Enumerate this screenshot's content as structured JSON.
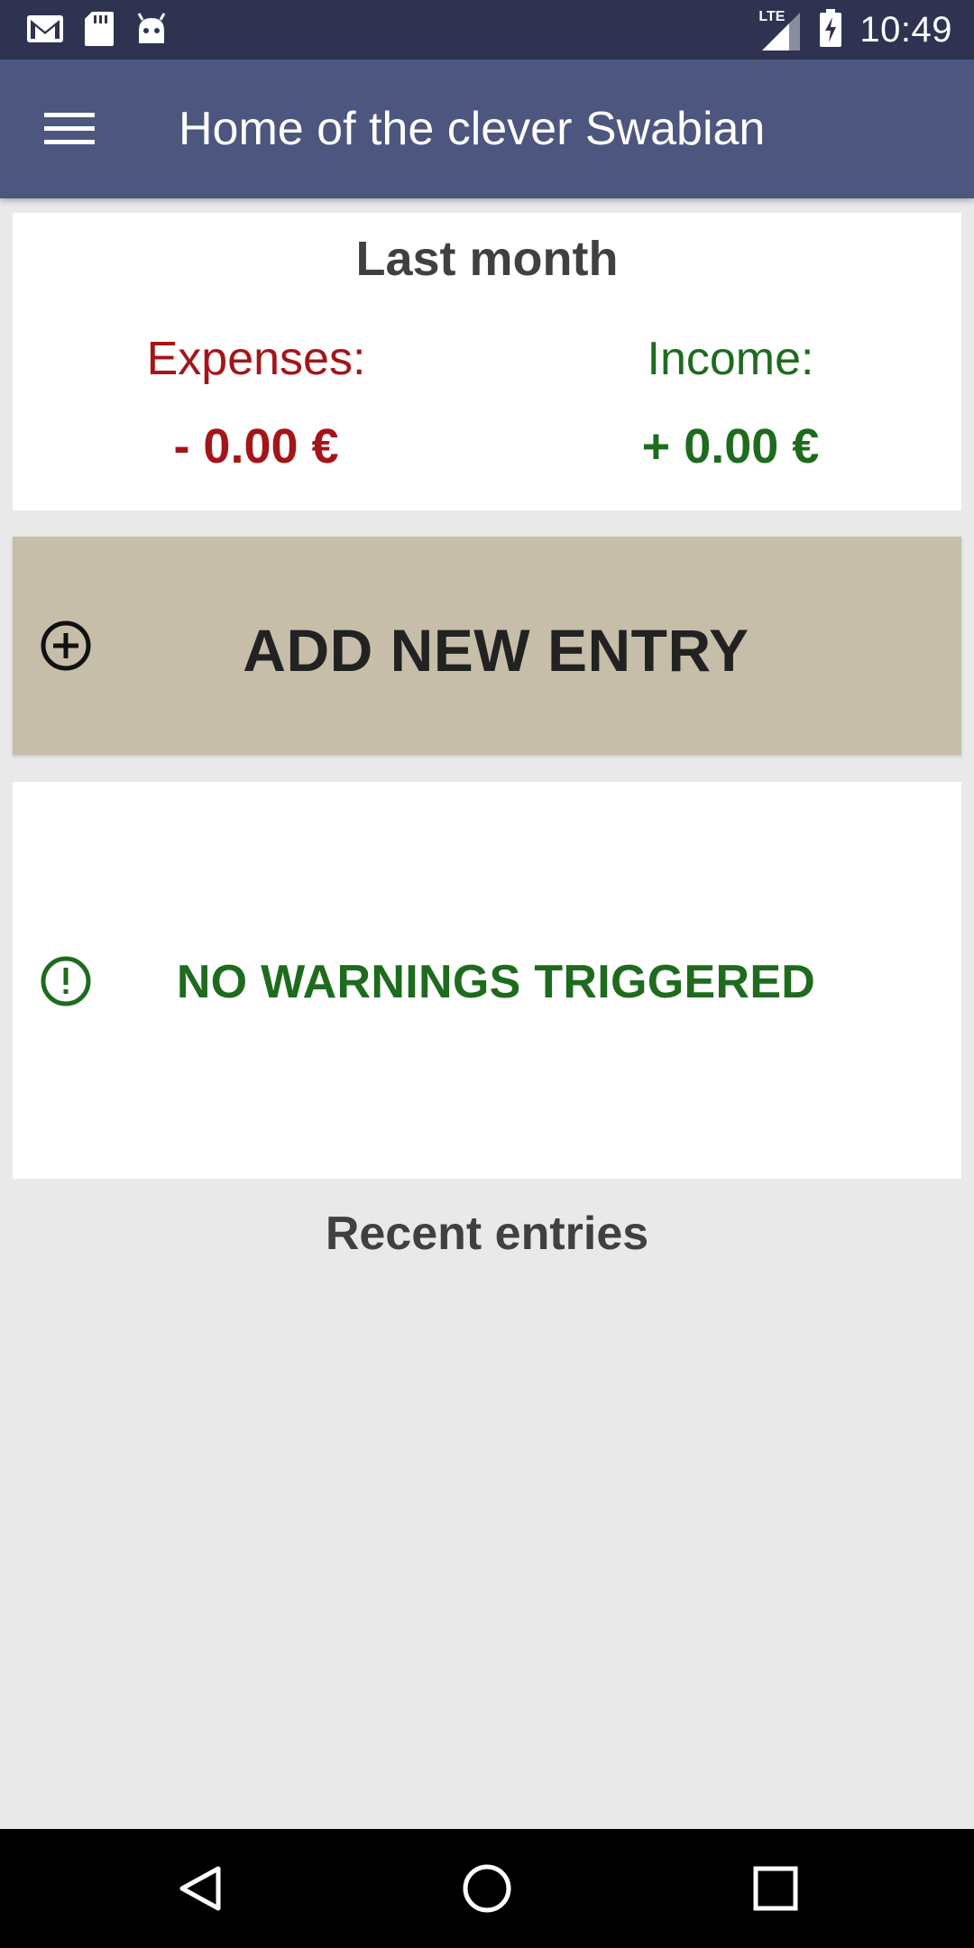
{
  "status_bar": {
    "time": "10:49",
    "network": "LTE",
    "icons": [
      "gmail-icon",
      "sd-card-icon",
      "android-icon",
      "signal-icon",
      "battery-charging-icon"
    ]
  },
  "app_bar": {
    "title": "Home of the clever Swabian",
    "menu_icon": "hamburger-menu-icon"
  },
  "summary": {
    "title": "Last month",
    "expenses_label": "Expenses:",
    "expenses_value": "- 0.00 €",
    "income_label": "Income:",
    "income_value": "+ 0.00 €"
  },
  "add_entry": {
    "label": "ADD NEW ENTRY",
    "icon": "add-circle-icon"
  },
  "warnings": {
    "label": "NO WARNINGS TRIGGERED",
    "icon": "alert-circle-icon"
  },
  "recent": {
    "title": "Recent entries"
  },
  "colors": {
    "status_bar": "#2f3351",
    "app_bar": "#4c567e",
    "expense": "#a51418",
    "income": "#1e6b1e",
    "add_button": "#c6bea8",
    "background": "#e9e9e9"
  }
}
